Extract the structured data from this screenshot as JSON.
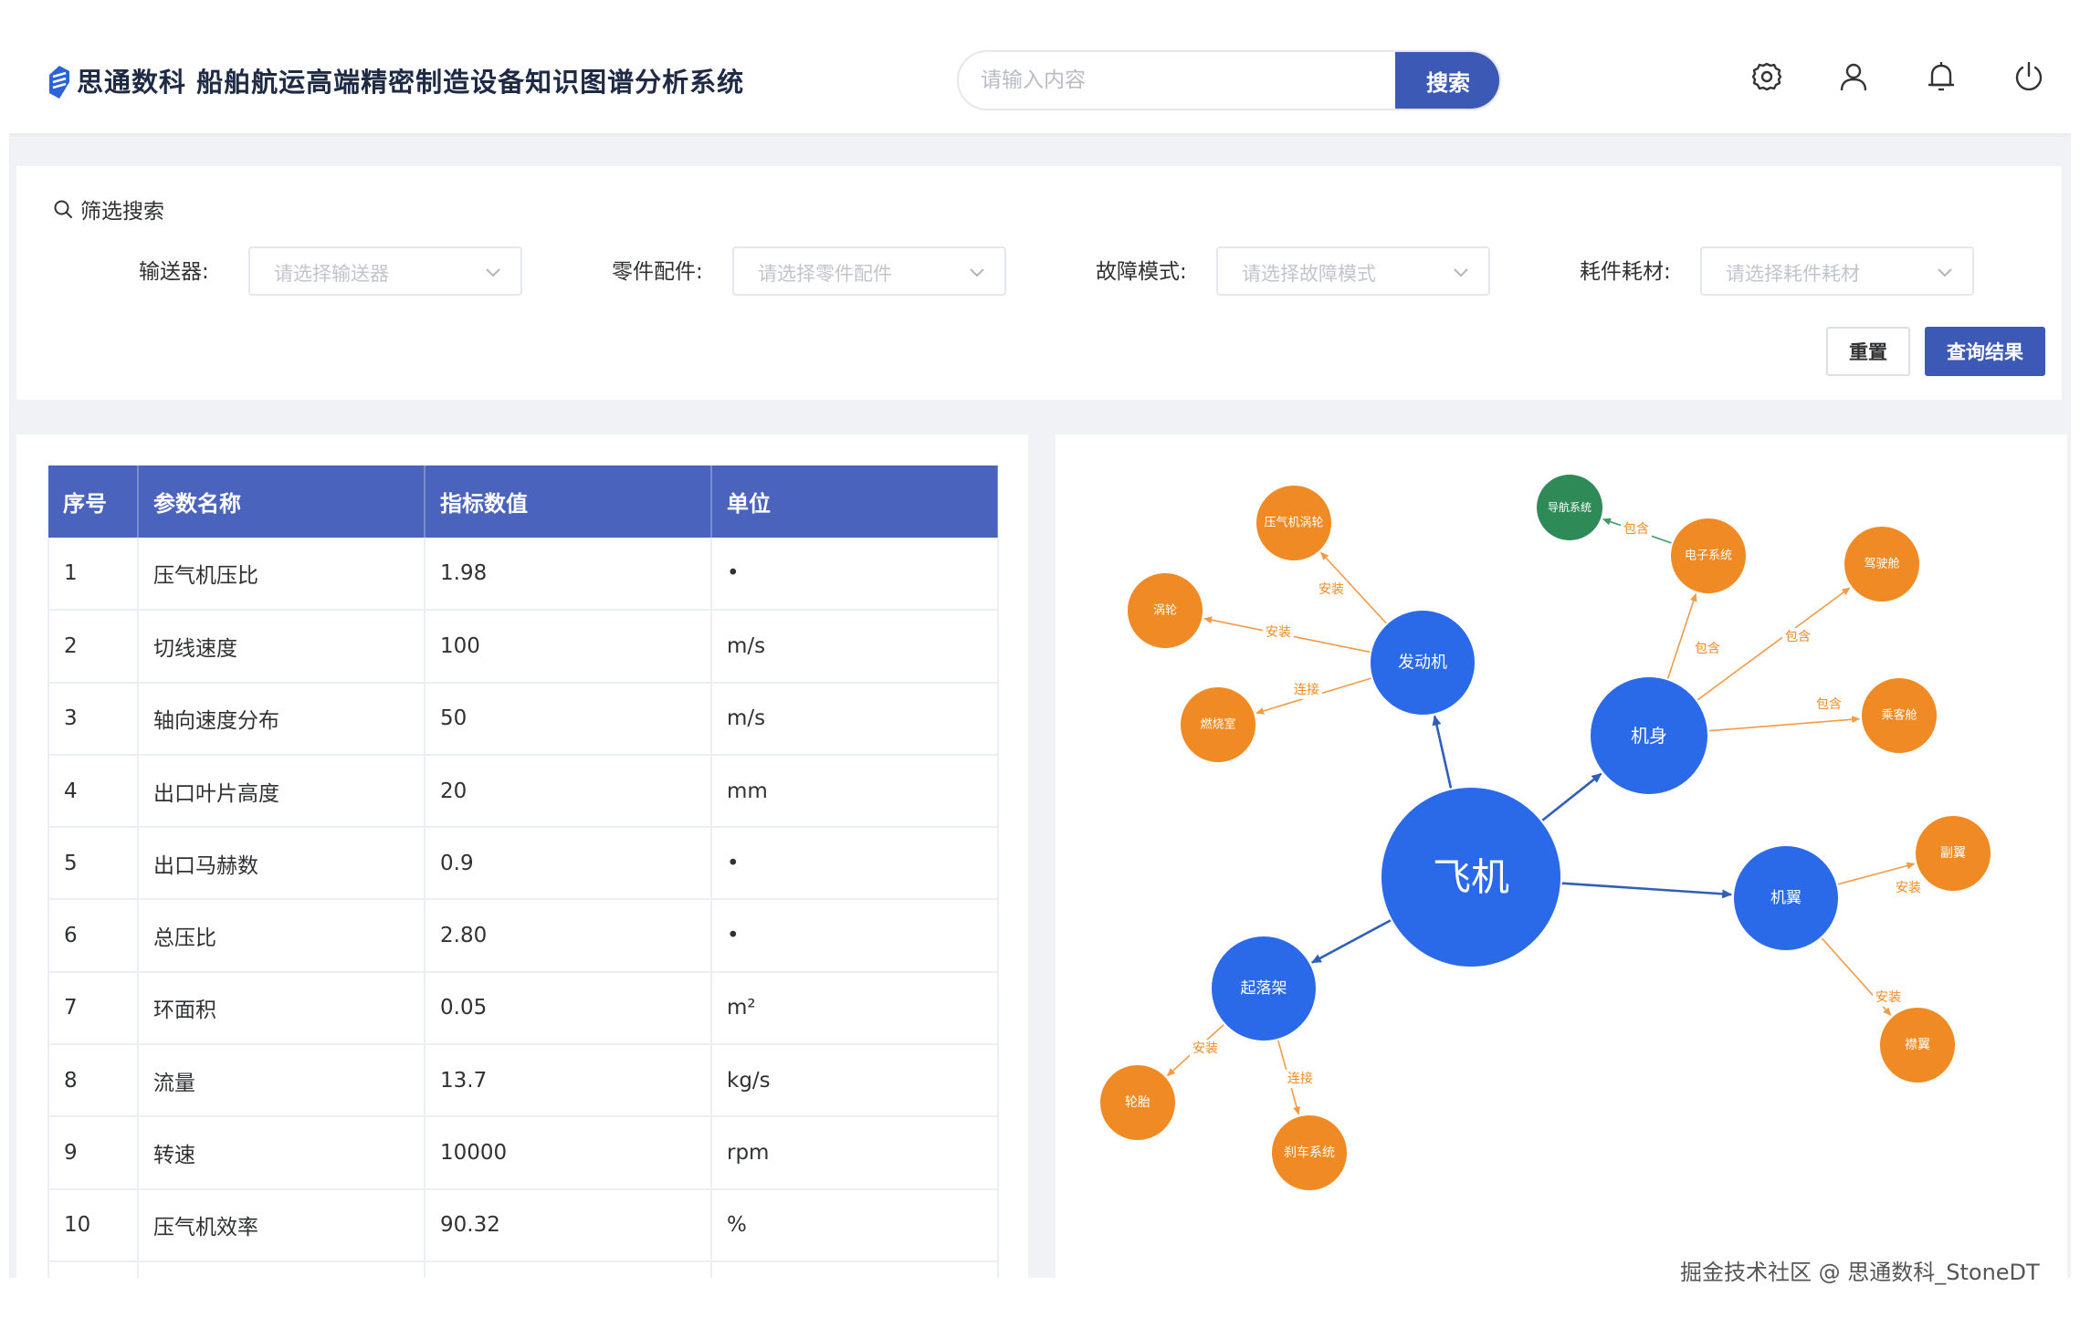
{
  "header": {
    "title": "思通数科 船舶航运高端精密制造设备知识图谱分析系统",
    "search_placeholder": "请输入内容",
    "search_button": "搜索",
    "icons": [
      "settings-icon",
      "user-icon",
      "bell-icon",
      "power-icon"
    ]
  },
  "filter": {
    "title": "筛选搜索",
    "fields": [
      {
        "label": "输送器:",
        "placeholder": "请选择输送器"
      },
      {
        "label": "零件配件:",
        "placeholder": "请选择零件配件"
      },
      {
        "label": "故障模式:",
        "placeholder": "请选择故障模式"
      },
      {
        "label": "耗件耗材:",
        "placeholder": "请选择耗件耗材"
      }
    ],
    "reset_button": "重置",
    "query_button": "查询结果"
  },
  "table": {
    "columns": [
      "序号",
      "参数名称",
      "指标数值",
      "单位"
    ],
    "rows": [
      [
        "1",
        "压气机压比",
        "1.98",
        "•"
      ],
      [
        "2",
        "切线速度",
        "100",
        "m/s"
      ],
      [
        "3",
        "轴向速度分布",
        "50",
        "m/s"
      ],
      [
        "4",
        "出口叶片高度",
        "20",
        "mm"
      ],
      [
        "5",
        "出口马赫数",
        "0.9",
        "•"
      ],
      [
        "6",
        "总压比",
        "2.80",
        "•"
      ],
      [
        "7",
        "环面积",
        "0.05",
        "m²"
      ],
      [
        "8",
        "流量",
        "13.7",
        "kg/s"
      ],
      [
        "9",
        "转速",
        "10000",
        "rpm"
      ],
      [
        "10",
        "压气机效率",
        "90.32",
        "%"
      ]
    ]
  },
  "graph": {
    "colors": {
      "primary": "#2a6ae8",
      "secondary": "#f08a24",
      "tertiary": "#2e8b57",
      "edge_blue": "#2f5fb8",
      "edge_orange": "#f39a46",
      "edge_green": "#3f9a63"
    },
    "nodes": [
      {
        "id": "plane",
        "label": "飞机",
        "type": "primary"
      },
      {
        "id": "engine",
        "label": "发动机",
        "type": "primary"
      },
      {
        "id": "body",
        "label": "机身",
        "type": "primary"
      },
      {
        "id": "wing",
        "label": "机翼",
        "type": "primary"
      },
      {
        "id": "gear",
        "label": "起落架",
        "type": "primary"
      },
      {
        "id": "turbine2",
        "label": "压气机涡轮",
        "type": "secondary"
      },
      {
        "id": "turbine",
        "label": "涡轮",
        "type": "secondary"
      },
      {
        "id": "combustor",
        "label": "燃烧室",
        "type": "secondary"
      },
      {
        "id": "electronic",
        "label": "电子系统",
        "type": "secondary"
      },
      {
        "id": "cockpit",
        "label": "驾驶舱",
        "type": "secondary"
      },
      {
        "id": "cabin",
        "label": "乘客舱",
        "type": "secondary"
      },
      {
        "id": "nav",
        "label": "导航系统",
        "type": "tertiary"
      },
      {
        "id": "aileron",
        "label": "副翼",
        "type": "secondary"
      },
      {
        "id": "flap",
        "label": "襟翼",
        "type": "secondary"
      },
      {
        "id": "tire",
        "label": "轮胎",
        "type": "secondary"
      },
      {
        "id": "brake",
        "label": "刹车系统",
        "type": "secondary"
      }
    ],
    "edges": [
      {
        "from": "plane",
        "to": "engine",
        "label": ""
      },
      {
        "from": "plane",
        "to": "body",
        "label": ""
      },
      {
        "from": "plane",
        "to": "wing",
        "label": ""
      },
      {
        "from": "plane",
        "to": "gear",
        "label": ""
      },
      {
        "from": "engine",
        "to": "turbine2",
        "label": "安装"
      },
      {
        "from": "engine",
        "to": "turbine",
        "label": "安装"
      },
      {
        "from": "engine",
        "to": "combustor",
        "label": "连接"
      },
      {
        "from": "body",
        "to": "electronic",
        "label": "包含"
      },
      {
        "from": "body",
        "to": "cockpit",
        "label": "包含"
      },
      {
        "from": "body",
        "to": "cabin",
        "label": "包含"
      },
      {
        "from": "electronic",
        "to": "nav",
        "label": "包含"
      },
      {
        "from": "wing",
        "to": "aileron",
        "label": "安装"
      },
      {
        "from": "wing",
        "to": "flap",
        "label": "安装"
      },
      {
        "from": "gear",
        "to": "tire",
        "label": "安装"
      },
      {
        "from": "gear",
        "to": "brake",
        "label": "连接"
      }
    ]
  },
  "watermark": "掘金技术社区 @ 思通数科_StoneDT"
}
